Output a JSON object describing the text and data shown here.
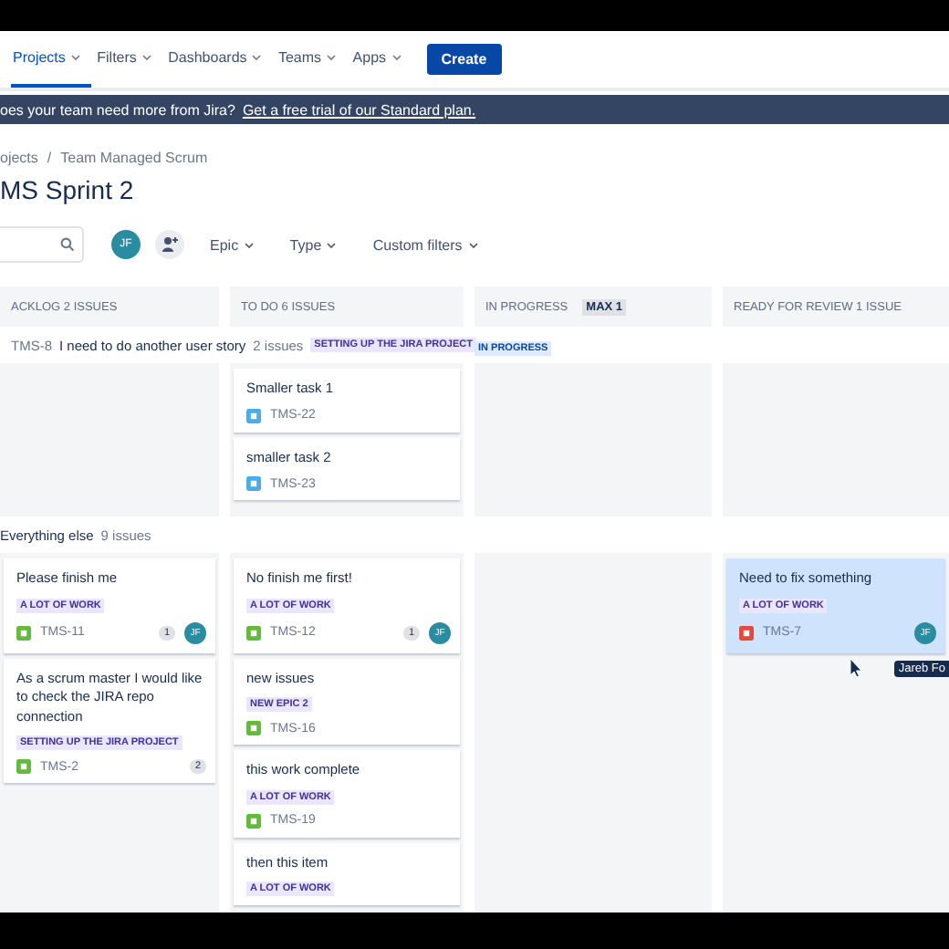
{
  "nav": {
    "items": [
      {
        "label": "Projects",
        "selected": true
      },
      {
        "label": "Filters",
        "selected": false
      },
      {
        "label": "Dashboards",
        "selected": false
      },
      {
        "label": "Teams",
        "selected": false
      },
      {
        "label": "Apps",
        "selected": false
      }
    ],
    "create": "Create"
  },
  "banner": {
    "text": "oes your team need more from Jira?",
    "link": "Get a free trial of our Standard plan."
  },
  "breadcrumb": {
    "items": [
      "ojects",
      "Team Managed Scrum"
    ],
    "separator": "/"
  },
  "title": "MS Sprint 2",
  "toolbar": {
    "avatar": "JF",
    "filters": [
      "Epic",
      "Type",
      "Custom filters"
    ]
  },
  "columns": [
    {
      "title": "ACKLOG",
      "count": "2 ISSUES"
    },
    {
      "title": "TO DO",
      "count": "6 ISSUES"
    },
    {
      "title": "IN PROGRESS",
      "max": "MAX 1"
    },
    {
      "title": "READY FOR REVIEW",
      "count": "1 ISSUE"
    }
  ],
  "lanes": [
    {
      "kind": "story",
      "key": "TMS-8",
      "title": "I need to do another user story",
      "count": "2 issues",
      "epic": "SETTING UP THE JIRA PROJECT",
      "status": "IN PROGRESS",
      "cells": [
        [],
        [
          {
            "title": "Smaller task 1",
            "kind": "subtask",
            "key": "TMS-22",
            "selected": false
          },
          {
            "title": "smaller task 2",
            "kind": "subtask",
            "key": "TMS-23",
            "selected": false
          }
        ],
        [],
        []
      ]
    },
    {
      "kind": "default",
      "title": "Everything else",
      "count": "9 issues",
      "cells": [
        [
          {
            "title": "Please finish me",
            "epic": "A LOT OF WORK",
            "kind": "story",
            "key": "TMS-11",
            "comments": "1",
            "assignee": "JF",
            "selected": false
          },
          {
            "title": "As a scrum master I would like to check the JIRA repo connection",
            "epic": "SETTING UP THE JIRA PROJECT",
            "kind": "story",
            "key": "TMS-2",
            "comments": "2",
            "selected": false
          }
        ],
        [
          {
            "title": "No finish me first!",
            "epic": "A LOT OF WORK",
            "kind": "story",
            "key": "TMS-12",
            "comments": "1",
            "assignee": "JF",
            "selected": false
          },
          {
            "title": "new issues",
            "epic": "NEW EPIC 2",
            "kind": "story",
            "key": "TMS-16",
            "selected": false
          },
          {
            "title": "this work complete",
            "epic": "A LOT OF WORK",
            "kind": "story",
            "key": "TMS-19",
            "selected": false
          },
          {
            "title": "then this item",
            "epic": "A LOT OF WORK",
            "selected": false
          }
        ],
        [],
        [
          {
            "title": "Need to fix something",
            "epic": "A LOT OF WORK",
            "kind": "bug",
            "key": "TMS-7",
            "assignee": "JF",
            "selected": true,
            "tooltip": "Jareb Fo"
          }
        ]
      ]
    }
  ]
}
